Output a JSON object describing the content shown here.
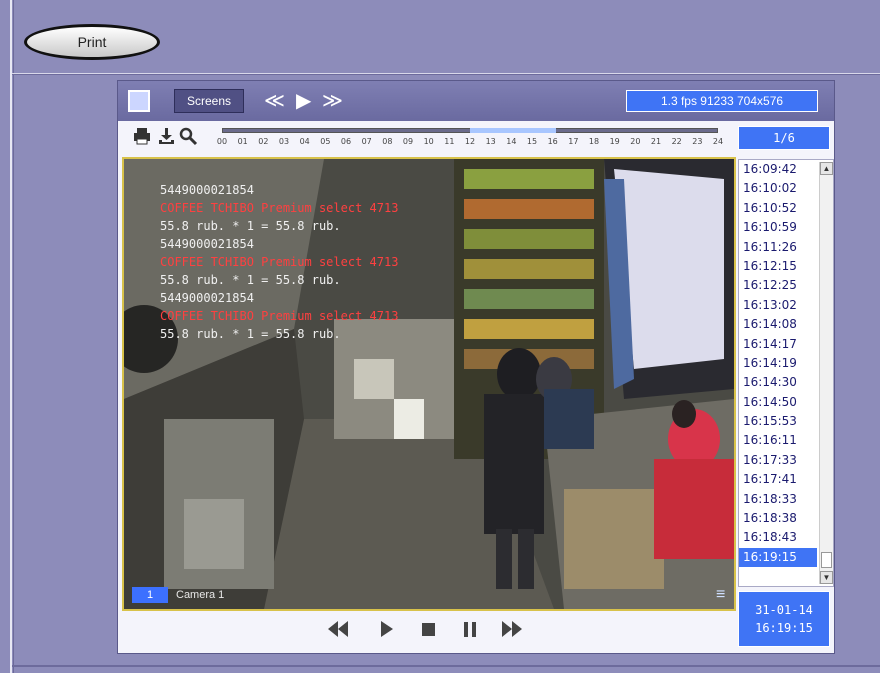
{
  "toolbar": {
    "print_label": "Print"
  },
  "viewer": {
    "screens_label": "Screens",
    "nav": {
      "prev": "≪",
      "play": "▶",
      "next": "≫"
    },
    "stream_info": "1.3 fps  91233 704x576",
    "page_indicator": "1/6",
    "timeline_hours": [
      "00",
      "01",
      "02",
      "03",
      "04",
      "05",
      "06",
      "07",
      "08",
      "09",
      "10",
      "11",
      "12",
      "13",
      "14",
      "15",
      "16",
      "17",
      "18",
      "19",
      "20",
      "21",
      "22",
      "23",
      "24"
    ],
    "overlay_lines": [
      {
        "text": "5449000021854",
        "color": "white"
      },
      {
        "text": "COFFEE TCHIBO Premium select 4713",
        "color": "red"
      },
      {
        "text": "55.8 rub. * 1 = 55.8 rub.",
        "color": "white"
      },
      {
        "text": "5449000021854",
        "color": "white"
      },
      {
        "text": "COFFEE TCHIBO Premium select 4713",
        "color": "red"
      },
      {
        "text": "55.8 rub. * 1 = 55.8 rub.",
        "color": "white"
      },
      {
        "text": "5449000021854",
        "color": "white"
      },
      {
        "text": "COFFEE TCHIBO Premium select 4713",
        "color": "red"
      },
      {
        "text": "55.8 rub. * 1 = 55.8 rub.",
        "color": "white"
      }
    ],
    "camera_number": "1",
    "camera_label": "Camera 1",
    "times": [
      "16:09:42",
      "16:10:02",
      "16:10:52",
      "16:10:59",
      "16:11:26",
      "16:12:15",
      "16:12:25",
      "16:13:02",
      "16:14:08",
      "16:14:17",
      "16:14:19",
      "16:14:30",
      "16:14:50",
      "16:15:53",
      "16:16:11",
      "16:17:33",
      "16:17:41",
      "16:18:33",
      "16:18:38",
      "16:18:43",
      "16:19:15"
    ],
    "selected_time_index": 20,
    "date": "31-01-14",
    "time": "16:19:15",
    "controls": {
      "rewind": "◀◀",
      "play": "▶",
      "stop": "■",
      "pause": "❚❚",
      "forward": "▶▶"
    }
  },
  "colors": {
    "accent": "#3f74f5",
    "frame": "#d8c24a",
    "background": "#8d8cba"
  }
}
